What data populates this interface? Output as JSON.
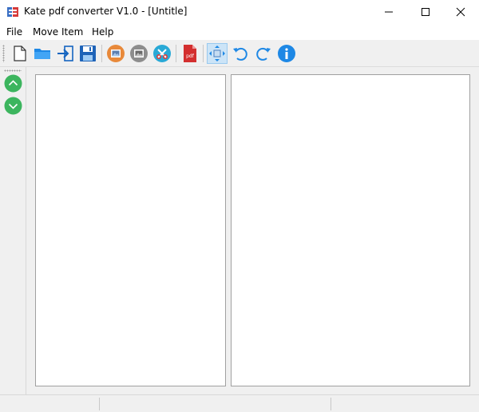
{
  "window": {
    "title": "Kate pdf converter V1.0 - [Untitle]",
    "controls": [
      "minimize",
      "maximize",
      "close"
    ]
  },
  "menu": {
    "items": [
      {
        "label": "File"
      },
      {
        "label": "Move Item"
      },
      {
        "label": "Help"
      }
    ]
  },
  "toolbar": {
    "buttons": [
      {
        "icon": "new-file-icon"
      },
      {
        "icon": "open-folder-icon"
      },
      {
        "icon": "import-icon"
      },
      {
        "icon": "save-icon"
      },
      {
        "icon": "image-orange-icon"
      },
      {
        "icon": "image-gray-icon"
      },
      {
        "icon": "tools-icon"
      },
      {
        "icon": "pdf-icon",
        "label": "pdf"
      },
      {
        "icon": "fit-arrows-icon",
        "active": true
      },
      {
        "icon": "rotate-left-icon"
      },
      {
        "icon": "rotate-right-icon"
      },
      {
        "icon": "info-icon"
      }
    ]
  },
  "sidebar": {
    "buttons": [
      {
        "icon": "move-up-icon"
      },
      {
        "icon": "move-down-icon"
      }
    ]
  },
  "colors": {
    "accent_blue": "#1e88e5",
    "green": "#3cb55e",
    "orange": "#e8893a",
    "teal": "#29a9d6",
    "pdf_red": "#d32f2f",
    "active_bg": "#cce4f7"
  }
}
